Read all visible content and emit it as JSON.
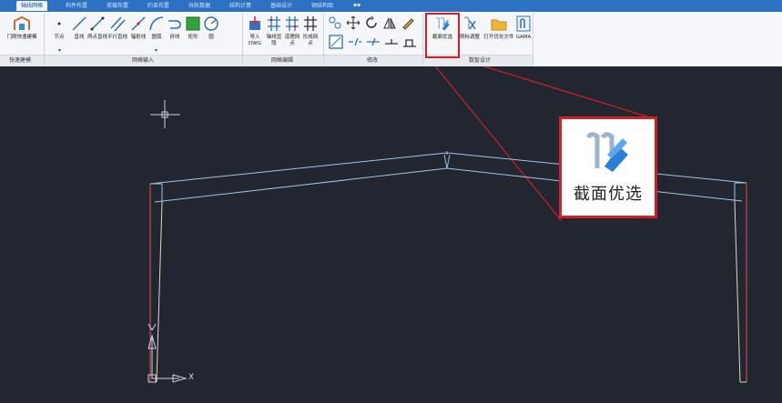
{
  "tabs": [
    {
      "label": "轴线网格",
      "active": true
    },
    {
      "label": "构件布置",
      "active": false
    },
    {
      "label": "荷载布置",
      "active": false
    },
    {
      "label": "约束布置",
      "active": false
    },
    {
      "label": "共轨数据",
      "active": false
    },
    {
      "label": "结构计算",
      "active": false
    },
    {
      "label": "基础设计",
      "active": false
    },
    {
      "label": "钢结构图",
      "active": false
    }
  ],
  "tab_more": "▪▪",
  "ribbon": {
    "quick_build": {
      "tool": "门刚快速建模",
      "group": "快速建模"
    },
    "grid_input": {
      "tools": [
        "节点",
        "直线",
        "两点直线",
        "平行直线",
        "辐射线",
        "圆弧",
        "折线",
        "矩形",
        "圆"
      ],
      "group": "网格输入"
    },
    "grid_edit": {
      "tools": [
        "导入DWG",
        "轴线显隐",
        "道理网点",
        "形成网点"
      ],
      "group": "网格编辑"
    },
    "modify": {
      "group": "修改"
    },
    "smart": {
      "tools": [
        "截面优选",
        "刚标调整",
        "打开优化文件",
        "GAMA"
      ],
      "group": "数智设计"
    }
  },
  "callout": {
    "label": "截面优选"
  },
  "axis": {
    "x_label": "X"
  },
  "colors": {
    "accent": "#2d71c2",
    "highlight": "#d21f26",
    "canvas": "#212630"
  }
}
